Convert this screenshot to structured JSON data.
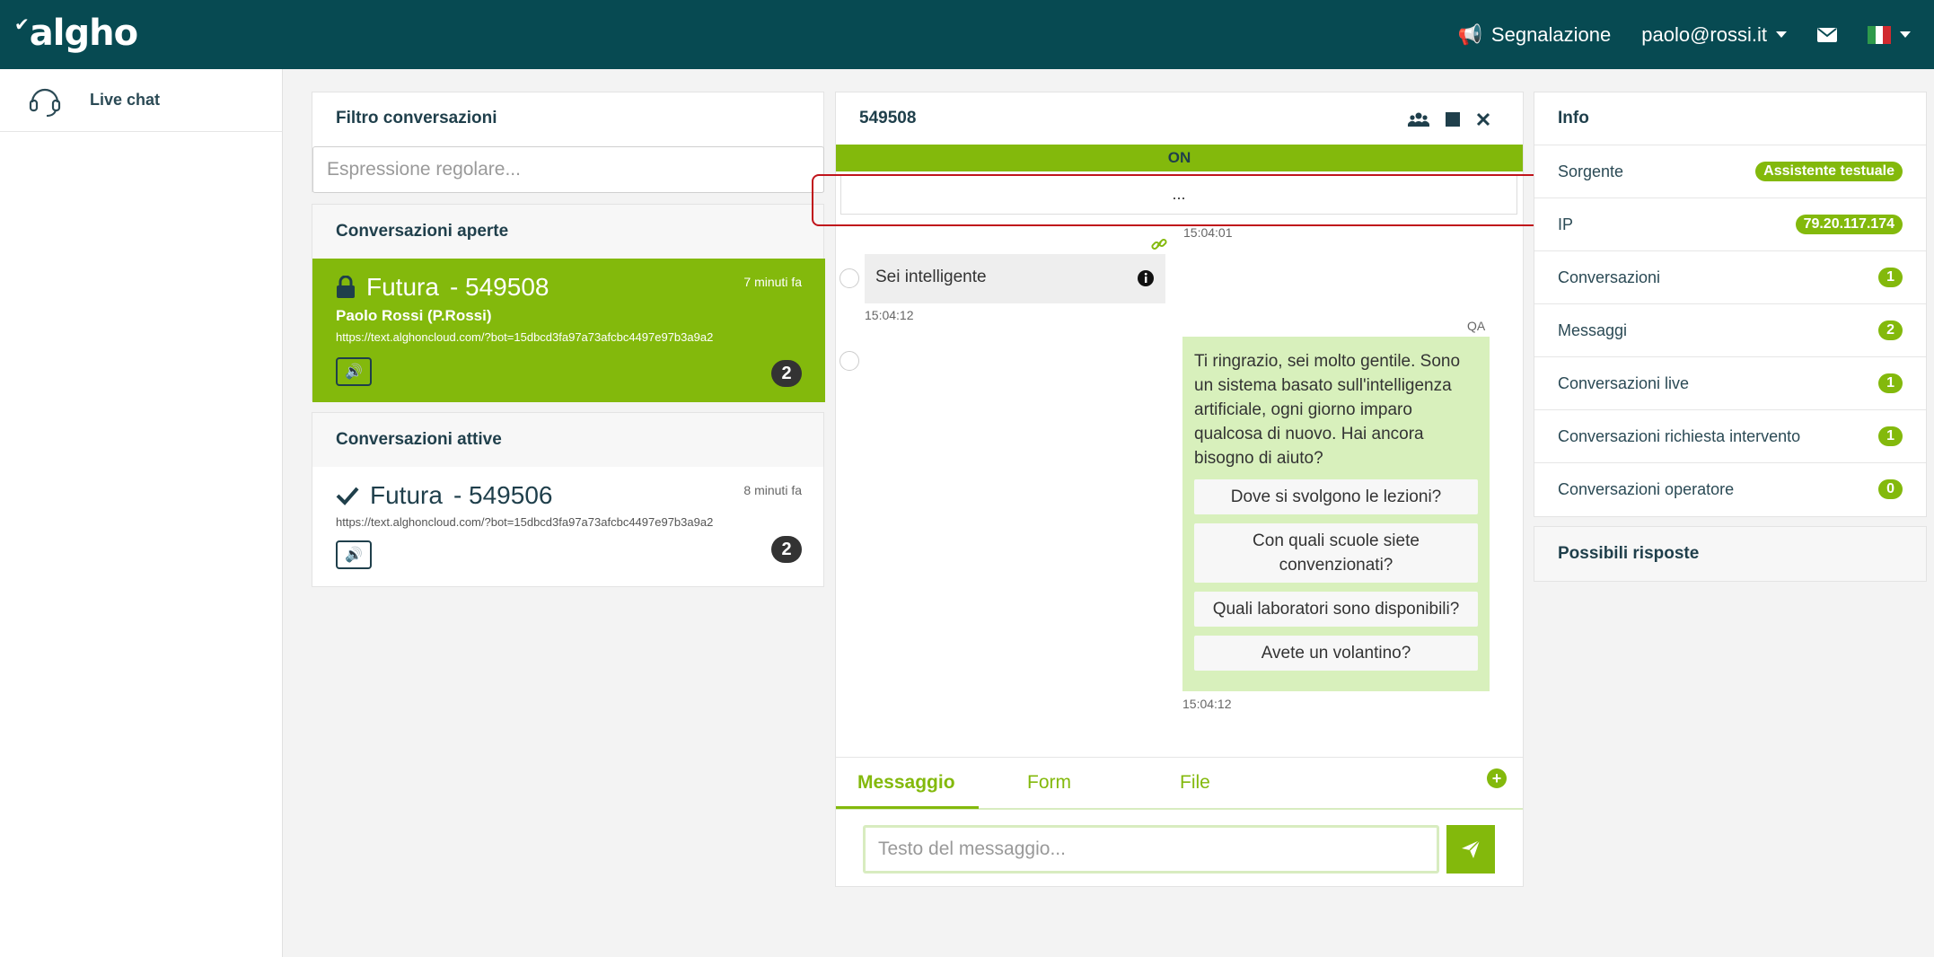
{
  "header": {
    "logo": "algho",
    "report_label": "Segnalazione",
    "user_email": "paolo@rossi.it",
    "colors": {
      "bar": "#074a52",
      "accent": "#83b90c"
    }
  },
  "sidebar": {
    "items": [
      {
        "label": "Live chat",
        "icon": "headset-icon"
      }
    ]
  },
  "filter": {
    "title": "Filtro conversazioni",
    "placeholder": "Espressione regolare..."
  },
  "open_conversations": {
    "title": "Conversazioni aperte",
    "items": [
      {
        "name": "Futura",
        "id": "- 549508",
        "time": "7 minuti fa",
        "user": "Paolo Rossi (P.Rossi)",
        "url": "https://text.alghoncloud.com/?bot=15dbcd3fa97a73afcbc4497e97b3a9a2",
        "count": "2",
        "status_icon": "lock-icon"
      }
    ]
  },
  "active_conversations": {
    "title": "Conversazioni attive",
    "items": [
      {
        "name": "Futura",
        "id": "- 549506",
        "time": "8 minuti fa",
        "url": "https://text.alghoncloud.com/?bot=15dbcd3fa97a73afcbc4497e97b3a9a2",
        "count": "2",
        "status_icon": "check-icon"
      }
    ]
  },
  "chat": {
    "title": "549508",
    "status": "ON",
    "loader": "...",
    "timestamp_top": "15:04:01",
    "user_message": "Sei intelligente",
    "user_time": "15:04:12",
    "bot_tag": "QA",
    "bot_message": "Ti ringrazio, sei molto gentile. Sono un sistema basato sull'intelligenza artificiale, ogni giorno imparo qualcosa di nuovo. Hai ancora bisogno di aiuto?",
    "suggestions": [
      "Dove si svolgono le lezioni?",
      "Con quali scuole siete convenzionati?",
      "Quali laboratori sono disponibili?",
      "Avete un volantino?"
    ],
    "bot_time": "15:04:12",
    "tabs": [
      "Messaggio",
      "Form",
      "File"
    ],
    "composer_placeholder": "Testo del messaggio..."
  },
  "info": {
    "title": "Info",
    "rows": [
      {
        "label": "Sorgente",
        "value": "Assistente testuale"
      },
      {
        "label": "IP",
        "value": "79.20.117.174"
      },
      {
        "label": "Conversazioni",
        "value": "1"
      },
      {
        "label": "Messaggi",
        "value": "2"
      },
      {
        "label": "Conversazioni live",
        "value": "1"
      },
      {
        "label": "Conversazioni richiesta intervento",
        "value": "1"
      },
      {
        "label": "Conversazioni operatore",
        "value": "0"
      }
    ]
  },
  "possible_answers": {
    "title": "Possibili risposte"
  }
}
